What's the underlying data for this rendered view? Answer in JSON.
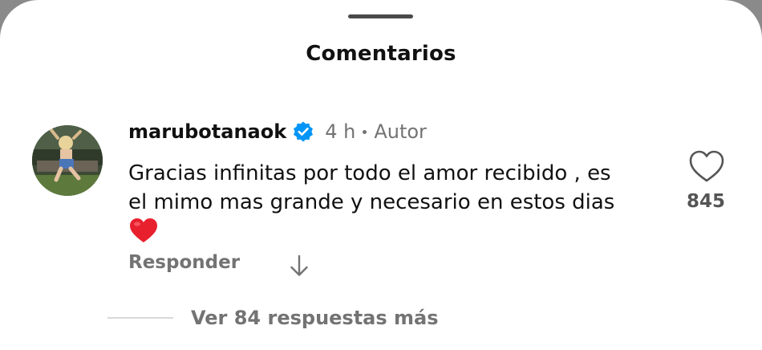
{
  "sheet": {
    "title": "Comentarios"
  },
  "comment": {
    "username": "marubotanaok",
    "verified": true,
    "time": "4 h",
    "author_label": "Autor",
    "text": "Gracias infinitas por todo el amor recibido , es\nel mimo mas grande y necesario en estos dias",
    "emoji": "red-heart-emoji",
    "reply_label": "Responder",
    "like_count": "845"
  },
  "replies": {
    "label": "Ver 84 respuestas más"
  },
  "colors": {
    "text_primary": "#111111",
    "text_secondary": "#737373",
    "verified_blue": "#0095f6",
    "heart_red": "#e8202e"
  }
}
